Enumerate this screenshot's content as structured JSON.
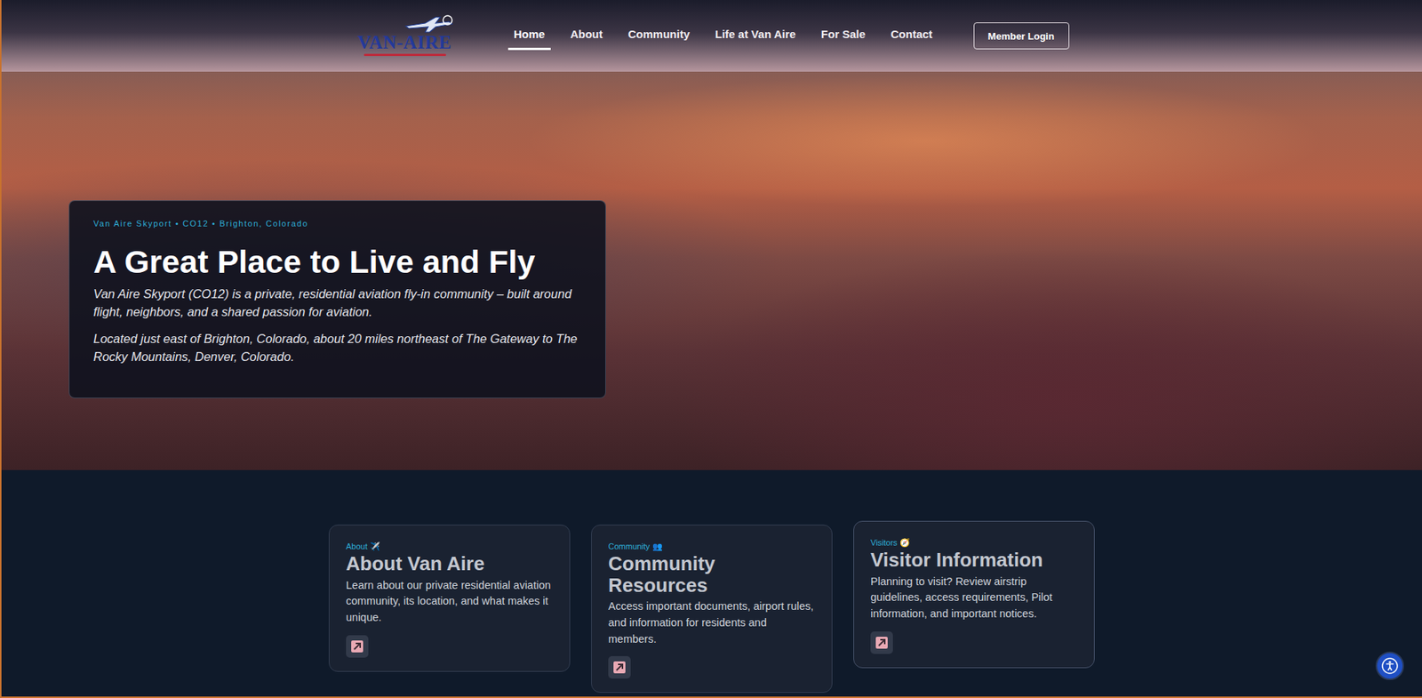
{
  "header": {
    "logo": "VAN-AIRE",
    "nav": [
      {
        "label": "Home",
        "selected": true
      },
      {
        "label": "About",
        "selected": false
      },
      {
        "label": "Community",
        "selected": false
      },
      {
        "label": "Life at Van Aire",
        "selected": false
      },
      {
        "label": "For Sale",
        "selected": false
      },
      {
        "label": "Contact",
        "selected": false
      }
    ],
    "login": "Member Login"
  },
  "hero": {
    "eyebrow": "Van Aire Skyport • CO12 • Brighton, Colorado",
    "title": "A Great Place to Live and Fly",
    "paragraphs": [
      "Van Aire Skyport (CO12) is a private, residential aviation fly-in community – built around flight, neighbors, and a shared passion for aviation.",
      "Located just east of Brighton, Colorado, about 20 miles northeast of The Gateway to The Rocky Mountains, Denver, Colorado."
    ]
  },
  "cards": [
    {
      "eyebrow": "About ✈️",
      "title": "About Van Aire",
      "text": "Learn about our private residential aviation community, its location, and what makes it unique.",
      "hovered": false
    },
    {
      "eyebrow": "Community 👥",
      "title": "Community Resources",
      "text": "Access important documents, airport rules, and information for residents and members.",
      "hovered": false
    },
    {
      "eyebrow": "Visitors 🧭",
      "title": "Visitor Information",
      "text": "Planning to visit? Review airstrip guidelines, access requirements, Pilot information, and important notices.",
      "hovered": true
    }
  ]
}
